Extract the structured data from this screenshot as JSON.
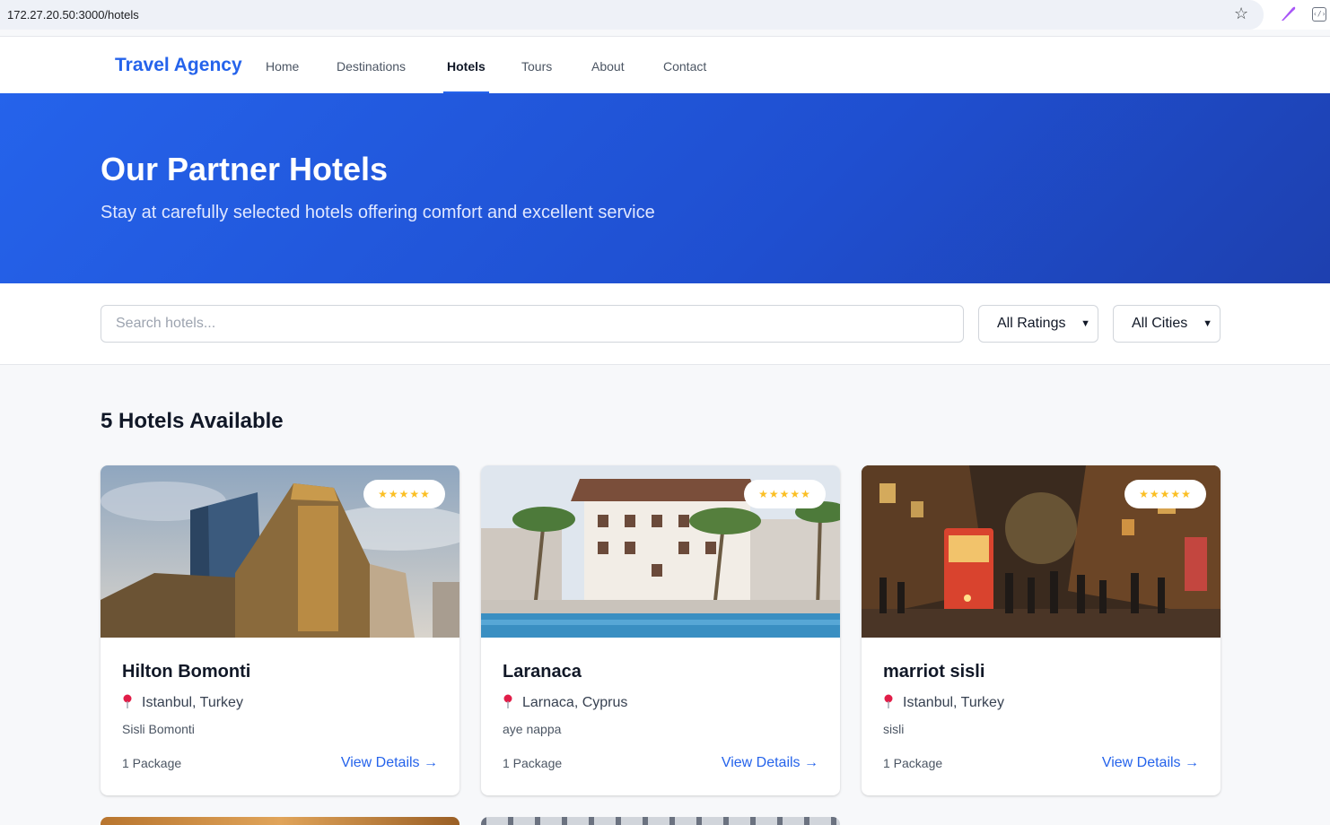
{
  "browser": {
    "url": "172.27.20.50:3000/hotels"
  },
  "nav": {
    "brand": "Travel Agency",
    "links": [
      {
        "label": "Home"
      },
      {
        "label": "Destinations"
      },
      {
        "label": "Hotels",
        "active": true
      },
      {
        "label": "Tours"
      },
      {
        "label": "About"
      },
      {
        "label": "Contact"
      }
    ]
  },
  "hero": {
    "title": "Our Partner Hotels",
    "subtitle": "Stay at carefully selected hotels offering comfort and excellent service"
  },
  "filters": {
    "search_placeholder": "Search hotels...",
    "rating_selected": "All Ratings",
    "city_selected": "All Cities"
  },
  "results": {
    "count_label": "5 Hotels Available",
    "hotels": [
      {
        "name": "Hilton Bomonti",
        "location": "Istanbul, Turkey",
        "area": "Sisli Bomonti",
        "packages": "1 Package",
        "stars": "★★★★★",
        "link": "View Details →"
      },
      {
        "name": "Laranaca",
        "location": "Larnaca, Cyprus",
        "area": "aye nappa",
        "packages": "1 Package",
        "stars": "★★★★★",
        "link": "View Details →"
      },
      {
        "name": "marriot sisli",
        "location": "Istanbul, Turkey",
        "area": "sisli",
        "packages": "1 Package",
        "stars": "★★★★★",
        "link": "View Details →"
      }
    ]
  },
  "colors": {
    "accent": "#2563eb",
    "hero_start": "#2563eb",
    "hero_end": "#1e40af",
    "star": "#fbbf24",
    "pin": "#e11d48"
  }
}
